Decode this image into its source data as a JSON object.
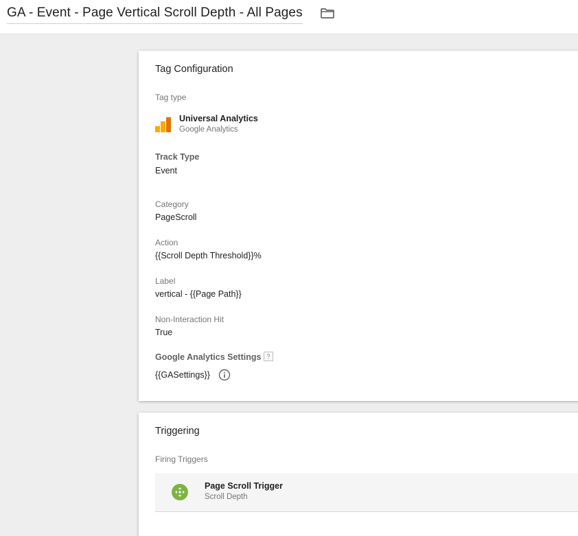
{
  "header": {
    "title": "GA - Event - Page Vertical Scroll Depth - All Pages",
    "folder_icon": "folder-icon"
  },
  "tag_configuration": {
    "title": "Tag Configuration",
    "tag_type_label": "Tag type",
    "tag_type_name": "Universal Analytics",
    "tag_type_sub": "Google Analytics",
    "tag_type_icon": "google-analytics-icon",
    "track_type_label": "Track Type",
    "track_type_value": "Event",
    "category_label": "Category",
    "category_value": "PageScroll",
    "action_label": "Action",
    "action_value": "{{Scroll Depth Threshold}}%",
    "label_label": "Label",
    "label_value": "vertical - {{Page Path}}",
    "non_interaction_label": "Non-Interaction Hit",
    "non_interaction_value": "True",
    "ga_settings_label": "Google Analytics Settings",
    "ga_settings_help": "?",
    "ga_settings_value": "{{GASettings}}",
    "info_icon": "info-icon"
  },
  "triggering": {
    "title": "Triggering",
    "firing_label": "Firing Triggers",
    "triggers": [
      {
        "name": "Page Scroll Trigger",
        "type": "Scroll Depth",
        "icon": "scroll-depth-icon"
      }
    ]
  },
  "colors": {
    "ga_orange_dark": "#E37400",
    "ga_orange": "#F9AB00",
    "trigger_green": "#7CB342",
    "background": "#EEEEEE"
  }
}
